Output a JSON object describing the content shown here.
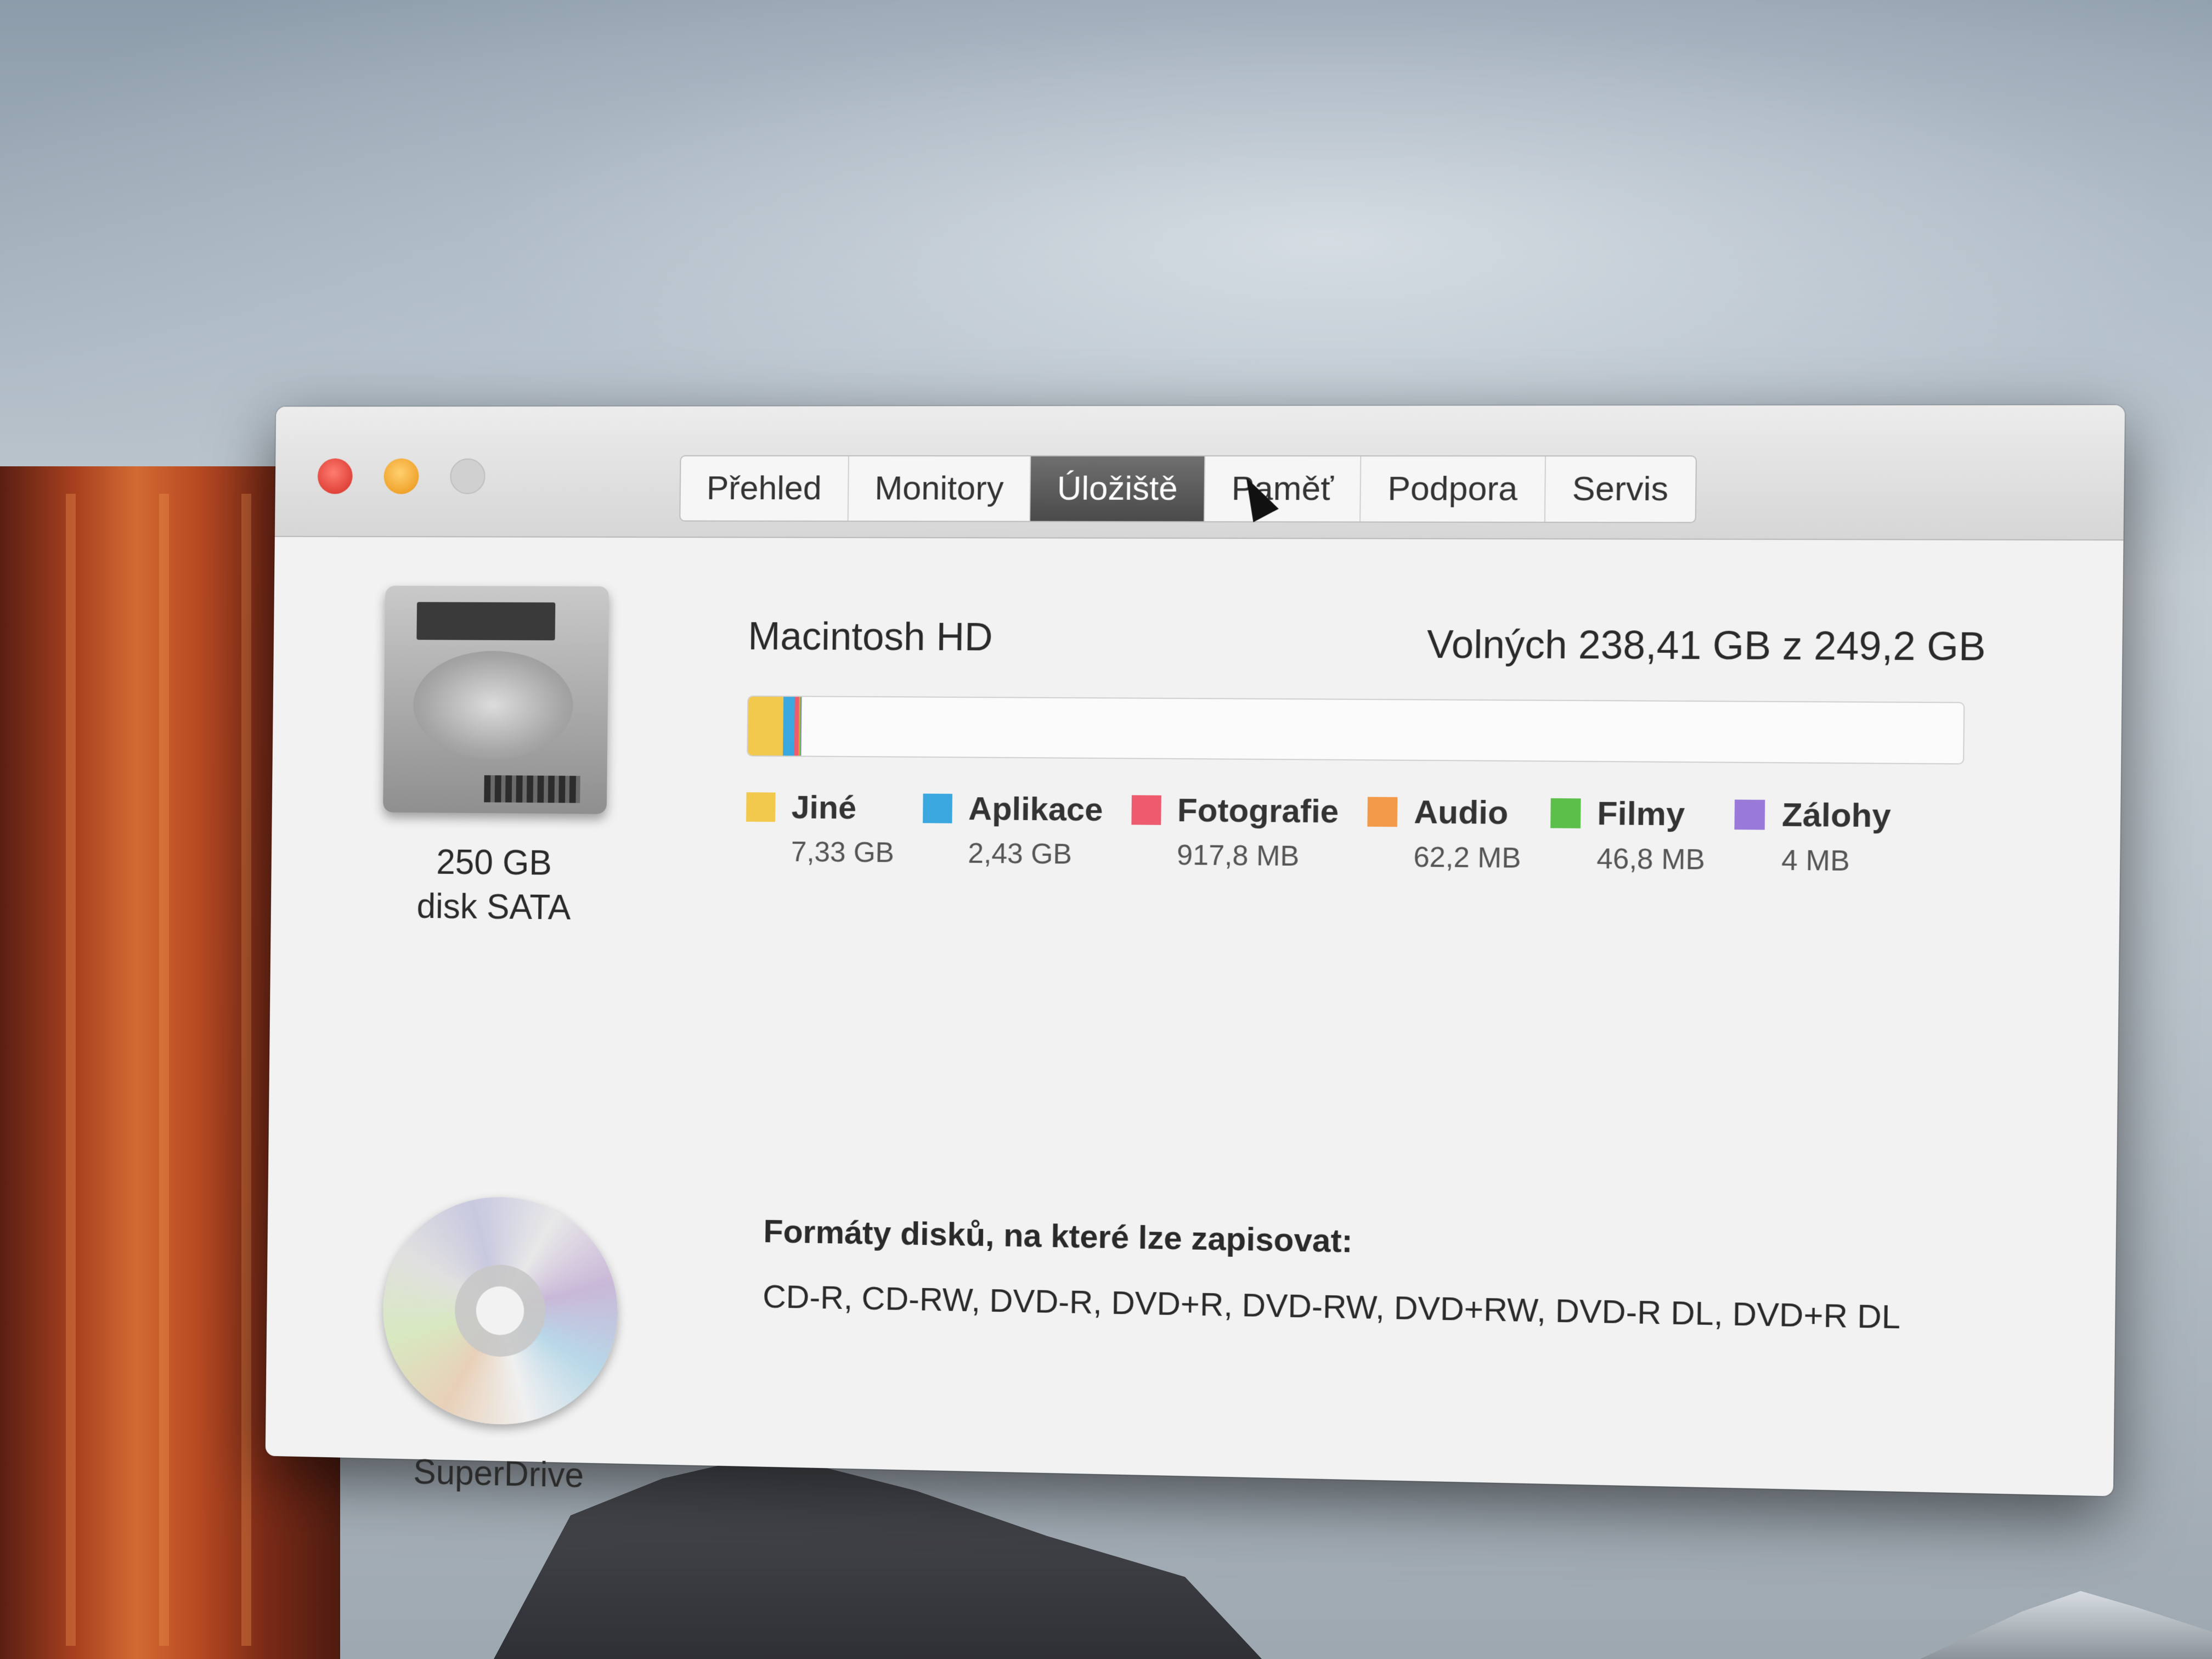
{
  "window": {
    "tabs": [
      {
        "label": "Přehled",
        "active": false
      },
      {
        "label": "Monitory",
        "active": false
      },
      {
        "label": "Úložiště",
        "active": true
      },
      {
        "label": "Paměť",
        "active": false
      },
      {
        "label": "Podpora",
        "active": false
      },
      {
        "label": "Servis",
        "active": false
      }
    ]
  },
  "storage": {
    "device_caption_line1": "250 GB",
    "device_caption_line2": "disk SATA",
    "disk_name": "Macintosh HD",
    "free_text": "Volných 238,41 GB z 249,2 GB",
    "usage_fraction_used": 0.045,
    "categories": [
      {
        "label": "Jiné",
        "size": "7,33 GB",
        "color": "#f2c94c",
        "share": 0.72
      },
      {
        "label": "Aplikace",
        "size": "2,43 GB",
        "color": "#3aa8de",
        "share": 0.24
      },
      {
        "label": "Fotografie",
        "size": "917,8 MB",
        "color": "#ee5a6e",
        "share": 0.09
      },
      {
        "label": "Audio",
        "size": "62,2 MB",
        "color": "#f39a4a",
        "share": 0.02
      },
      {
        "label": "Filmy",
        "size": "46,8 MB",
        "color": "#5cbf4a",
        "share": 0.02
      },
      {
        "label": "Zálohy",
        "size": "4 MB",
        "color": "#9a7ad8",
        "share": 0.01
      }
    ]
  },
  "optical": {
    "caption": "SuperDrive",
    "formats_title": "Formáty disků, na které lze zapisovat:",
    "formats_list": "CD-R, CD-RW, DVD-R, DVD+R, DVD-RW, DVD+RW, DVD-R DL, DVD+R DL"
  },
  "icons": {
    "hard_drive": "hard-drive-icon",
    "optical_disc": "optical-disc-icon",
    "cursor": "mouse-pointer-icon"
  }
}
